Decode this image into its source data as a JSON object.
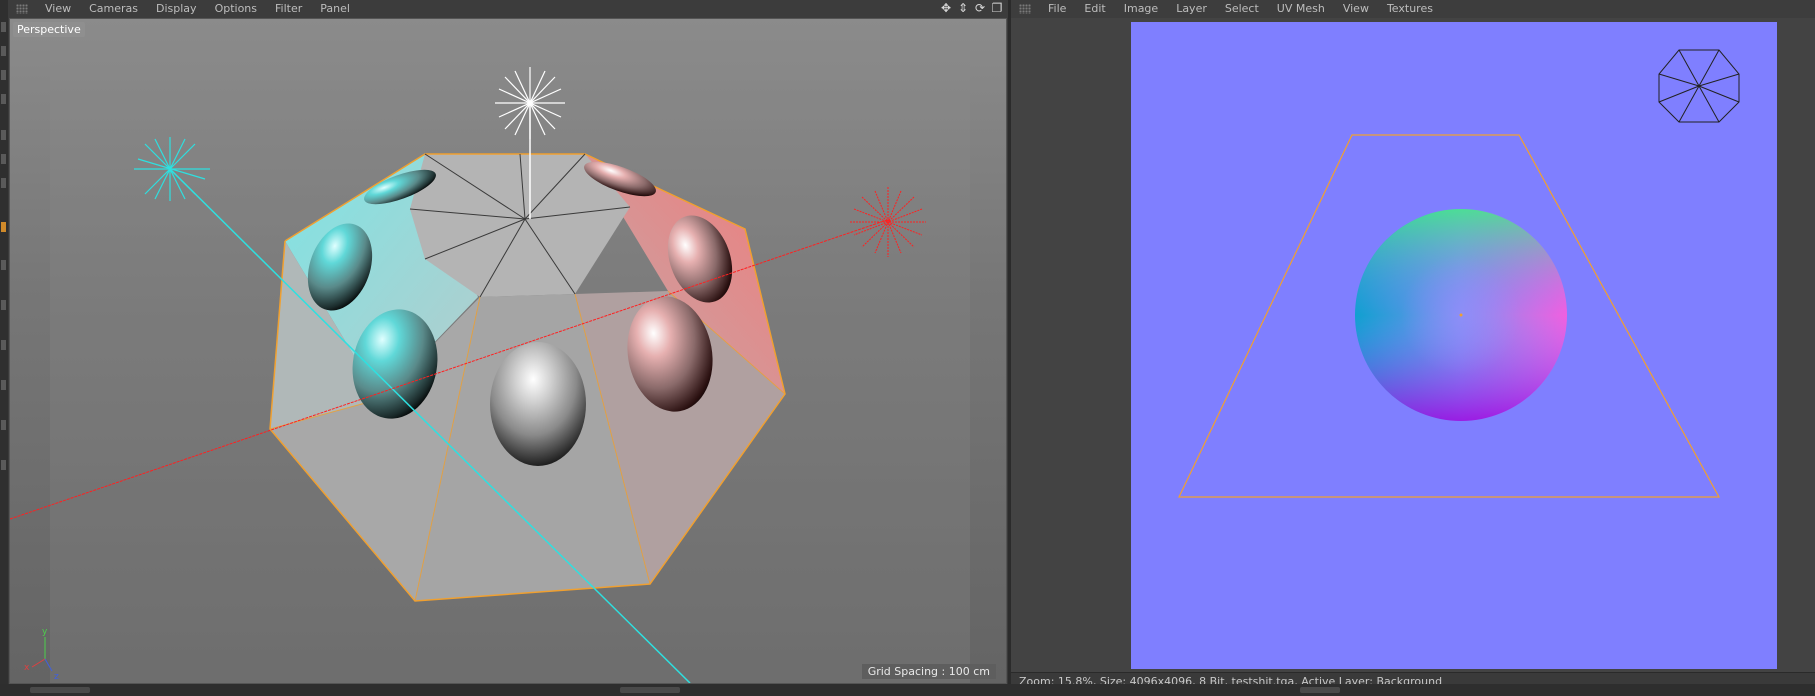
{
  "left_panel": {
    "menu": [
      "View",
      "Cameras",
      "Display",
      "Options",
      "Filter",
      "Panel"
    ],
    "viewport_label": "Perspective",
    "grid_spacing": "Grid Spacing : 100 cm",
    "nav_icons": [
      "move-view-icon",
      "dolly-view-icon",
      "rotate-view-icon",
      "maximize-view-icon"
    ],
    "axis_labels": {
      "x": "x",
      "y": "y",
      "z": "z"
    }
  },
  "right_panel": {
    "menu": [
      "File",
      "Edit",
      "Image",
      "Layer",
      "Select",
      "UV Mesh",
      "View",
      "Textures"
    ],
    "status": "Zoom: 15.8%, Size: 4096x4096, 8 Bit, testshit.tga, Active Layer: Background"
  },
  "colors": {
    "normal_map_bg": "#7f7fff",
    "uv_edge": "#f0a030",
    "light_cyan": "#2ee0e0",
    "light_red": "#ff2020",
    "light_white": "#ffffff",
    "selection_orange": "#f0a030"
  }
}
